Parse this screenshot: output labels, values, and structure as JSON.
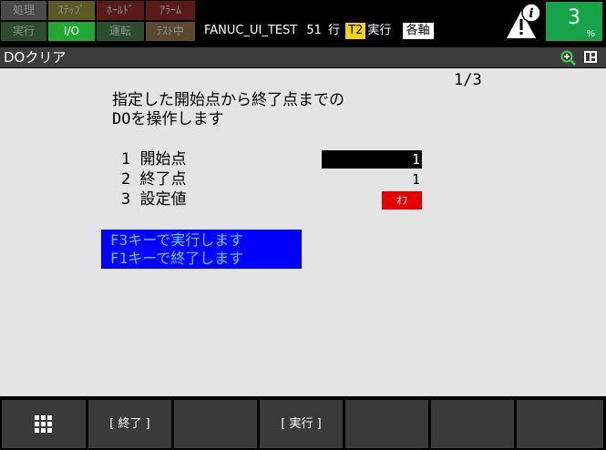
{
  "indicators": [
    {
      "label": "処理",
      "bg": "#4a4a4a",
      "active": false
    },
    {
      "label": "ｽﾃｯﾌﾟ",
      "bg": "#5b5a22",
      "active": false
    },
    {
      "label": "ﾎｰﾙﾄﾞ",
      "bg": "#5a1a1a",
      "active": false
    },
    {
      "label": "ｱﾗｰﾑ",
      "bg": "#5a1a1a",
      "active": false
    },
    {
      "label": "実行",
      "bg": "#2b4d2b",
      "active": false
    },
    {
      "label": "I/O",
      "bg": "#22a832",
      "active": true
    },
    {
      "label": "運転",
      "bg": "#2b4d2b",
      "active": false
    },
    {
      "label": "ﾃｽﾄ中",
      "bg": "#5a4a30",
      "active": false
    }
  ],
  "status_line": {
    "program": "FANUC_UI_TEST",
    "line_no": "51",
    "line_label": "行",
    "mode_badge": "T2",
    "state": "実行",
    "coord": "各軸"
  },
  "override": {
    "value": "3",
    "unit": "%"
  },
  "title_bar": {
    "title": "DOクリア"
  },
  "content": {
    "page": "1/3",
    "instructions": [
      "指定した開始点から終了点までの",
      "DOを操作します"
    ],
    "rows": [
      {
        "label": "1 開始点",
        "value": "1"
      },
      {
        "label": "2 終了点",
        "value": "1"
      },
      {
        "label": "3 設定値",
        "value": "ｵﾌ"
      }
    ],
    "messages": [
      "F3キーで実行します",
      "F1キーで終了します"
    ]
  },
  "colors": {
    "override_bg": "#16a34a",
    "message_bg": "#0000ff",
    "message_text": "#5ad1ff",
    "setvalue_bg": "#e20000",
    "mode_badge": "#f5d400"
  },
  "softkeys": [
    "",
    "[ 終了 ]",
    "",
    "[ 実行 ]",
    "",
    "",
    ""
  ]
}
